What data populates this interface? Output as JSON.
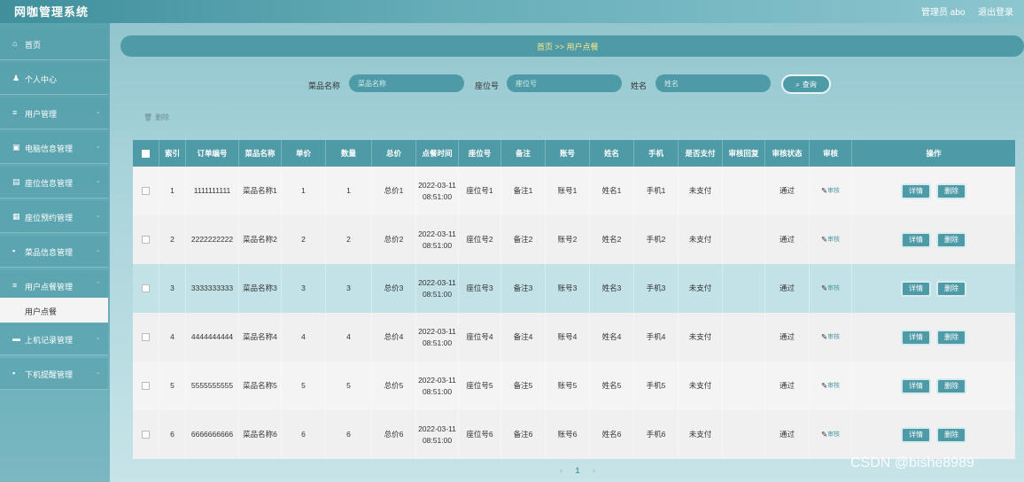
{
  "app": {
    "title": "网咖管理系统"
  },
  "topbar": {
    "user_label": "管理员 abo",
    "logout_label": "退出登录"
  },
  "sidebar": {
    "items": [
      {
        "label": "首页",
        "icon": "home-icon",
        "glyph": "⌂"
      },
      {
        "label": "个人中心",
        "icon": "user-icon",
        "glyph": "♟"
      },
      {
        "label": "用户管理",
        "icon": "list-icon",
        "glyph": "≡"
      },
      {
        "label": "电脑信息管理",
        "icon": "computer-icon",
        "glyph": "▣"
      },
      {
        "label": "座位信息管理",
        "icon": "seat-icon",
        "glyph": "▤"
      },
      {
        "label": "座位预约管理",
        "icon": "grid-icon",
        "glyph": "▦"
      },
      {
        "label": "菜品信息管理",
        "icon": "food-icon",
        "glyph": "▪"
      },
      {
        "label": "用户点餐管理",
        "icon": "list-icon",
        "glyph": "≡"
      },
      {
        "label": "上机记录管理",
        "icon": "record-icon",
        "glyph": "▬"
      },
      {
        "label": "下机提醒管理",
        "icon": "bell-icon",
        "glyph": "▪"
      }
    ],
    "submenu_label": "用户点餐"
  },
  "breadcrumb": {
    "text": "首页 >> 用户点餐"
  },
  "search": {
    "dish_label": "菜品名称",
    "dish_placeholder": "菜品名称",
    "seat_label": "座位号",
    "seat_placeholder": "座位号",
    "name_label": "姓名",
    "name_placeholder": "姓名",
    "button_label": "查询"
  },
  "toolbar": {
    "delete_label": "删除"
  },
  "table": {
    "headers": [
      "索引",
      "订单编号",
      "菜品名称",
      "单价",
      "数量",
      "总价",
      "点餐时间",
      "座位号",
      "备注",
      "账号",
      "姓名",
      "手机",
      "是否支付",
      "审核回复",
      "审核状态",
      "审核",
      "操作"
    ],
    "rows": [
      {
        "index": "1",
        "order": "1111111111",
        "dish": "菜品名称1",
        "price": "1",
        "qty": "1",
        "total": "总价1",
        "time": "2022-03-11 08:51:00",
        "seat": "座位号1",
        "remark": "备注1",
        "account": "账号1",
        "name": "姓名1",
        "phone": "手机1",
        "paid": "未支付",
        "reply": "",
        "status": "通过",
        "audit": "审核"
      },
      {
        "index": "2",
        "order": "2222222222",
        "dish": "菜品名称2",
        "price": "2",
        "qty": "2",
        "total": "总价2",
        "time": "2022-03-11 08:51:00",
        "seat": "座位号2",
        "remark": "备注2",
        "account": "账号2",
        "name": "姓名2",
        "phone": "手机2",
        "paid": "未支付",
        "reply": "",
        "status": "通过",
        "audit": "审核"
      },
      {
        "index": "3",
        "order": "3333333333",
        "dish": "菜品名称3",
        "price": "3",
        "qty": "3",
        "total": "总价3",
        "time": "2022-03-11 08:51:00",
        "seat": "座位号3",
        "remark": "备注3",
        "account": "账号3",
        "name": "姓名3",
        "phone": "手机3",
        "paid": "未支付",
        "reply": "",
        "status": "通过",
        "audit": "审核"
      },
      {
        "index": "4",
        "order": "4444444444",
        "dish": "菜品名称4",
        "price": "4",
        "qty": "4",
        "total": "总价4",
        "time": "2022-03-11 08:51:00",
        "seat": "座位号4",
        "remark": "备注4",
        "account": "账号4",
        "name": "姓名4",
        "phone": "手机4",
        "paid": "未支付",
        "reply": "",
        "status": "通过",
        "audit": "审核"
      },
      {
        "index": "5",
        "order": "5555555555",
        "dish": "菜品名称5",
        "price": "5",
        "qty": "5",
        "total": "总价5",
        "time": "2022-03-11 08:51:00",
        "seat": "座位号5",
        "remark": "备注5",
        "account": "账号5",
        "name": "姓名5",
        "phone": "手机5",
        "paid": "未支付",
        "reply": "",
        "status": "通过",
        "audit": "审核"
      },
      {
        "index": "6",
        "order": "6666666666",
        "dish": "菜品名称6",
        "price": "6",
        "qty": "6",
        "total": "总价6",
        "time": "2022-03-11 08:51:00",
        "seat": "座位号6",
        "remark": "备注6",
        "account": "账号6",
        "name": "姓名6",
        "phone": "手机6",
        "paid": "未支付",
        "reply": "",
        "status": "通过",
        "audit": "审核"
      }
    ],
    "detail_label": "详情",
    "delete_label": "删除"
  },
  "pager": {
    "prev": "‹",
    "current": "1",
    "next": "›"
  },
  "watermark": "CSDN @bishe8989",
  "colors": {
    "accent": "#4e9aa6",
    "highlight_row": "#c3e2e7"
  }
}
